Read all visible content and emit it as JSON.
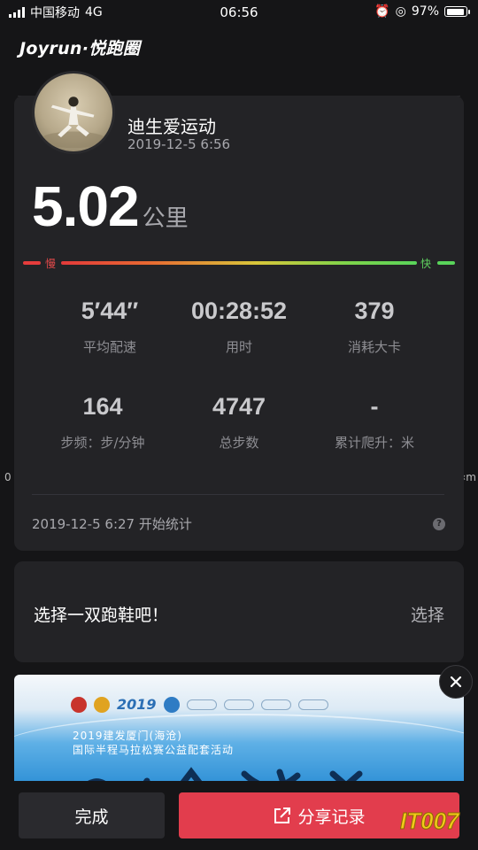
{
  "status_bar": {
    "carrier": "中国移动",
    "network": "4G",
    "time": "06:56",
    "battery": "97%"
  },
  "header": {
    "brand": "Joyrun·悦跑圈"
  },
  "side_labels": {
    "left": "0",
    "right": "‹m"
  },
  "run": {
    "user_name": "迪生爱运动",
    "datetime": "2019-12-5 6:56",
    "distance": "5.02",
    "distance_unit": "公里",
    "speed_slow_label": "慢",
    "speed_fast_label": "快",
    "stats": [
      {
        "value": "5′44″",
        "label": "平均配速"
      },
      {
        "value": "00:28:52",
        "label": "用时"
      },
      {
        "value": "379",
        "label": "消耗大卡"
      },
      {
        "value": "164",
        "label": "步频：步/分钟"
      },
      {
        "value": "4747",
        "label": "总步数"
      },
      {
        "value": "-",
        "label": "累计爬升：米"
      }
    ],
    "start_text": "2019-12-5 6:27 开始统计",
    "help": "?"
  },
  "shoe": {
    "prompt": "选择一双跑鞋吧！",
    "action": "选择"
  },
  "banner": {
    "year": "2019",
    "line1": "2019建发厦门(海沧)",
    "line2": "国际半程马拉松赛公益配套活动"
  },
  "actions": {
    "done": "完成",
    "share": "分享记录"
  },
  "watermark": "IT007",
  "colors": {
    "background": "#151517",
    "card": "#232326",
    "share_button": "#e23d4d",
    "slow": "#e63c3c",
    "fast": "#59d45a"
  }
}
